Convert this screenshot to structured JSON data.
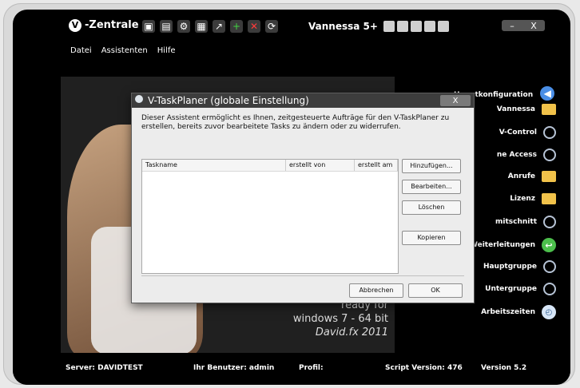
{
  "app": {
    "brand": "-Zentrale",
    "brand_letter": "V",
    "product": "Vannessa 5+",
    "menu": [
      "Datei",
      "Assistenten",
      "Hilfe"
    ]
  },
  "window_controls": {
    "minimize": "–",
    "close": "X"
  },
  "toolbar": {
    "icons": [
      "save-icon",
      "open-icon",
      "settings-icon",
      "print-icon",
      "export-icon",
      "add-icon",
      "delete-icon",
      "refresh-icon"
    ]
  },
  "photo": {
    "ready_line1": "ready for",
    "ready_line2": "windows 7 - 64 bit",
    "ready_line3": "David.fx 2011"
  },
  "right_nav": {
    "header": "Hauptkonfiguration",
    "items": [
      {
        "label": "Vannessa",
        "icon": "folder"
      },
      {
        "label": "V-Control",
        "icon": "key"
      },
      {
        "label": "ne Access",
        "icon": "key"
      },
      {
        "label": "Anrufe",
        "icon": "folder"
      },
      {
        "label": "Lizenz",
        "icon": "folder"
      },
      {
        "label": "mitschnitt",
        "icon": "key"
      },
      {
        "label": "Weiterleitungen",
        "icon": "green"
      },
      {
        "label": "Hauptgruppe",
        "icon": "key"
      },
      {
        "label": "Untergruppe",
        "icon": "key"
      },
      {
        "label": "Arbeitszeiten",
        "icon": "blue"
      }
    ]
  },
  "status_bar": {
    "server": "Server: DAVIDTEST",
    "user": "Ihr Benutzer: admin",
    "profile": "Profil:",
    "script_version": "Script Version: 476",
    "version": "Version 5.2"
  },
  "modal": {
    "title": "V-TaskPlaner (globale Einstellung)",
    "description": "Dieser Assistent ermöglicht es Ihnen, zeitgesteuerte Aufträge für den V-TaskPlaner zu erstellen, bereits zuvor bearbeitete Tasks zu ändern oder zu widerrufen.",
    "columns": [
      "Taskname",
      "erstellt von",
      "erstellt am"
    ],
    "buttons": {
      "add": "Hinzufügen...",
      "edit": "Bearbeiten...",
      "delete": "Löschen",
      "copy": "Kopieren",
      "cancel": "Abbrechen",
      "ok": "OK"
    },
    "close": "X"
  },
  "colors": {
    "app_bg": "#000000",
    "dialog_bg": "#ececec",
    "title_bg": "#3d3d3d",
    "folder": "#f1c24a",
    "arrow": "#4a8ee6"
  }
}
